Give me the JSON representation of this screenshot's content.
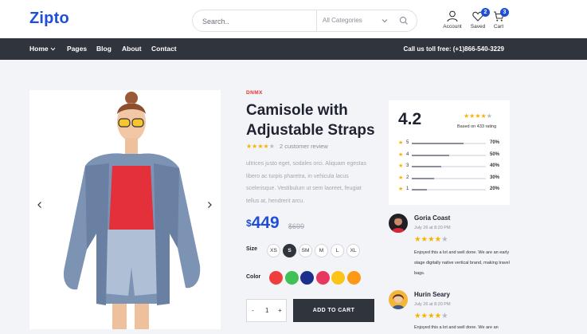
{
  "header": {
    "logo": "Zipto",
    "search_placeholder": "Search..",
    "category": "All Categories",
    "account_label": "Account",
    "saved_label": "Saved",
    "saved_count": "2",
    "cart_label": "Cart",
    "cart_count": "3"
  },
  "nav": {
    "items": [
      "Home",
      "Pages",
      "Blog",
      "About",
      "Contact"
    ],
    "call_text": "Call us toll free: (+1)866-540-3229"
  },
  "product": {
    "brand": "DNMX",
    "title": "Camisole with Adjustable Straps",
    "rating_stars": 4,
    "review_count_text": "2 customer review",
    "description": "ultrices justo eget, sodales orci. Aliquam egestas libero ac turpis pharetra, in vehicula lacus scelerisque. Vestibulum ut sem laoreet, feugiat tellus at, hendrerit arcu.",
    "price_currency": "$",
    "price": "449",
    "old_price": "$699",
    "size_label": "Size",
    "sizes": [
      "XS",
      "S",
      "SM",
      "M",
      "L",
      "XL"
    ],
    "selected_size": "S",
    "color_label": "Color",
    "colors": [
      "#f03e3e",
      "#40c057",
      "#1c2f8a",
      "#e8375e",
      "#fcc419",
      "#fd9a13"
    ],
    "qty_minus": "-",
    "quantity": "1",
    "qty_plus": "+",
    "add_to_cart": "ADD TO CART",
    "accent_color": "#1f4fd6"
  },
  "rating_summary": {
    "average": "4.2",
    "stars": 4,
    "based_on": "Based on 433 rating",
    "rows": [
      {
        "star": "5",
        "percent": "70%",
        "fraction": 0.7
      },
      {
        "star": "4",
        "percent": "50%",
        "fraction": 0.5
      },
      {
        "star": "3",
        "percent": "40%",
        "fraction": 0.4
      },
      {
        "star": "2",
        "percent": "30%",
        "fraction": 0.3
      },
      {
        "star": "1",
        "percent": "20%",
        "fraction": 0.2
      }
    ]
  },
  "reviews": [
    {
      "name": "Goria Coast",
      "date": "July 26 at 8:20 PM",
      "stars": 4,
      "text": "Enjoyed this a lot and well done. We are an early stage digitally native vertical brand, making travel bags."
    },
    {
      "name": "Hurin Seary",
      "date": "July 26 at 8:20 PM",
      "stars": 4,
      "text": "Enjoyed this a lot and well done. We are an"
    }
  ]
}
